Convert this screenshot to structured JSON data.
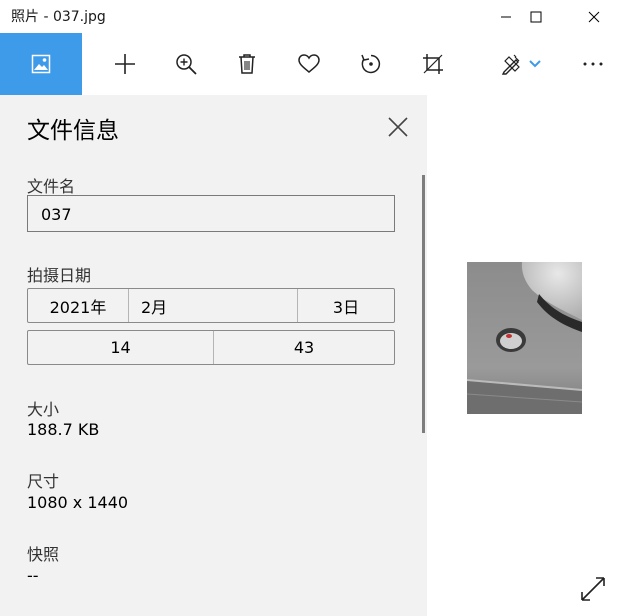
{
  "window": {
    "title": "照片 - 037.jpg",
    "icons": {
      "minimize": "minimize-icon",
      "maximize": "maximize-icon",
      "close": "close-icon"
    }
  },
  "toolbar": {
    "buttons": [
      {
        "name": "view-image",
        "icon": "image-icon"
      },
      {
        "name": "add",
        "icon": "plus-icon"
      },
      {
        "name": "zoom",
        "icon": "zoom-in-icon"
      },
      {
        "name": "delete",
        "icon": "trash-icon"
      },
      {
        "name": "favorite",
        "icon": "heart-icon"
      },
      {
        "name": "rotate",
        "icon": "rotate-icon"
      },
      {
        "name": "crop",
        "icon": "crop-icon"
      },
      {
        "name": "edit",
        "icon": "edit-draw-icon"
      },
      {
        "name": "more",
        "icon": "more-icon"
      }
    ],
    "accent_color": "#3d9be9"
  },
  "info_panel": {
    "title": "文件信息",
    "filename": {
      "label": "文件名",
      "value": "037"
    },
    "date_taken": {
      "label": "拍摄日期",
      "year": "2021年",
      "month": "2月",
      "day": "3日",
      "hour": "14",
      "minute": "43"
    },
    "size": {
      "label": "大小",
      "value": "188.7 KB"
    },
    "dimensions": {
      "label": "尺寸",
      "value": "1080 x 1440"
    },
    "snapshot": {
      "label": "快照",
      "value": "--"
    }
  },
  "viewer": {
    "photo_name": "037.jpg",
    "expand_icon": "expand-icon"
  }
}
